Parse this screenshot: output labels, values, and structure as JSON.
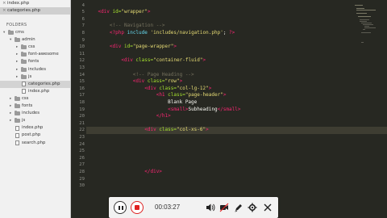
{
  "open_files": [
    {
      "name": "index.php",
      "active": false
    },
    {
      "name": "categories.php",
      "active": true
    }
  ],
  "sidebar": {
    "folders_title": "FOLDERS",
    "tree": [
      {
        "label": "cms",
        "type": "folder",
        "depth": 0,
        "open": true
      },
      {
        "label": "admin",
        "type": "folder",
        "depth": 1,
        "open": true
      },
      {
        "label": "css",
        "type": "folder",
        "depth": 2,
        "open": false
      },
      {
        "label": "font-awesome",
        "type": "folder",
        "depth": 2,
        "open": false
      },
      {
        "label": "fonts",
        "type": "folder",
        "depth": 2,
        "open": false
      },
      {
        "label": "includes",
        "type": "folder",
        "depth": 2,
        "open": false
      },
      {
        "label": "js",
        "type": "folder",
        "depth": 2,
        "open": false
      },
      {
        "label": "categories.php",
        "type": "file",
        "depth": 2,
        "selected": true
      },
      {
        "label": "index.php",
        "type": "file",
        "depth": 2
      },
      {
        "label": "css",
        "type": "folder",
        "depth": 1,
        "open": false
      },
      {
        "label": "fonts",
        "type": "folder",
        "depth": 1,
        "open": false
      },
      {
        "label": "includes",
        "type": "folder",
        "depth": 1,
        "open": false
      },
      {
        "label": "js",
        "type": "folder",
        "depth": 1,
        "open": false
      },
      {
        "label": "index.php",
        "type": "file",
        "depth": 1
      },
      {
        "label": "post.php",
        "type": "file",
        "depth": 1
      },
      {
        "label": "search.php",
        "type": "file",
        "depth": 1
      }
    ]
  },
  "editor": {
    "line_numbers": [
      "4",
      "5",
      "6",
      "7",
      "8",
      "9",
      "10",
      "11",
      "12",
      "13",
      "14",
      "15",
      "16",
      "17",
      "18",
      "19",
      "20",
      "21",
      "22",
      "23",
      "24",
      "25",
      "26",
      "27",
      "28",
      "29",
      "30"
    ],
    "current_line": "22",
    "lines": [
      [],
      [
        {
          "t": "    ",
          "c": "txt"
        },
        {
          "t": "<div ",
          "c": "tag"
        },
        {
          "t": "id=",
          "c": "attr"
        },
        {
          "t": "\"wrapper\"",
          "c": "str"
        },
        {
          "t": ">",
          "c": "tag"
        }
      ],
      [],
      [
        {
          "t": "        <!-- Navigation -->",
          "c": "cmt"
        }
      ],
      [
        {
          "t": "        ",
          "c": "txt"
        },
        {
          "t": "<?php ",
          "c": "tag"
        },
        {
          "t": "include ",
          "c": "php"
        },
        {
          "t": "'includes/navigation.php'",
          "c": "str"
        },
        {
          "t": "; ",
          "c": "txt"
        },
        {
          "t": "?>",
          "c": "tag"
        }
      ],
      [],
      [
        {
          "t": "        ",
          "c": "txt"
        },
        {
          "t": "<div ",
          "c": "tag"
        },
        {
          "t": "id=",
          "c": "attr"
        },
        {
          "t": "\"page-wrapper\"",
          "c": "str"
        },
        {
          "t": ">",
          "c": "tag"
        }
      ],
      [],
      [
        {
          "t": "            ",
          "c": "txt"
        },
        {
          "t": "<div ",
          "c": "tag"
        },
        {
          "t": "class=",
          "c": "attr"
        },
        {
          "t": "\"container-fluid\"",
          "c": "str"
        },
        {
          "t": ">",
          "c": "tag"
        }
      ],
      [],
      [
        {
          "t": "                <!-- Page Heading -->",
          "c": "cmt"
        }
      ],
      [
        {
          "t": "                ",
          "c": "txt"
        },
        {
          "t": "<div ",
          "c": "tag"
        },
        {
          "t": "class=",
          "c": "attr"
        },
        {
          "t": "\"row\"",
          "c": "str"
        },
        {
          "t": ">",
          "c": "tag"
        }
      ],
      [
        {
          "t": "                    ",
          "c": "txt"
        },
        {
          "t": "<div ",
          "c": "tag"
        },
        {
          "t": "class=",
          "c": "attr"
        },
        {
          "t": "\"col-lg-12\"",
          "c": "str"
        },
        {
          "t": ">",
          "c": "tag"
        }
      ],
      [
        {
          "t": "                        ",
          "c": "txt"
        },
        {
          "t": "<h1 ",
          "c": "tag"
        },
        {
          "t": "class=",
          "c": "attr"
        },
        {
          "t": "\"page-header\"",
          "c": "str"
        },
        {
          "t": ">",
          "c": "tag"
        }
      ],
      [
        {
          "t": "                            Blank Page",
          "c": "txt"
        }
      ],
      [
        {
          "t": "                            ",
          "c": "txt"
        },
        {
          "t": "<small>",
          "c": "tag"
        },
        {
          "t": "Subheading",
          "c": "txt"
        },
        {
          "t": "</small>",
          "c": "tag"
        }
      ],
      [
        {
          "t": "                        ",
          "c": "txt"
        },
        {
          "t": "</h1>",
          "c": "tag"
        }
      ],
      [],
      [
        {
          "t": "                    ",
          "c": "txt"
        },
        {
          "t": "<div ",
          "c": "tag"
        },
        {
          "t": "class=",
          "c": "attr"
        },
        {
          "t": "\"col-xs-6\"",
          "c": "str"
        },
        {
          "t": ">",
          "c": "tag"
        }
      ],
      [],
      [],
      [],
      [],
      [],
      [
        {
          "t": "                    ",
          "c": "txt"
        },
        {
          "t": "</div>",
          "c": "tag"
        }
      ],
      [],
      []
    ]
  },
  "player": {
    "time": "00:03:27",
    "icons": [
      "pause-icon",
      "stop-icon",
      "volume-icon",
      "webcam-icon",
      "pen-icon",
      "settings-icon",
      "close-icon"
    ]
  },
  "colors": {
    "editor_bg": "#272822",
    "tag": "#f92672",
    "attribute": "#a6e22e",
    "string": "#e6db74",
    "comment": "#75715e",
    "stop_red": "#e02020"
  }
}
